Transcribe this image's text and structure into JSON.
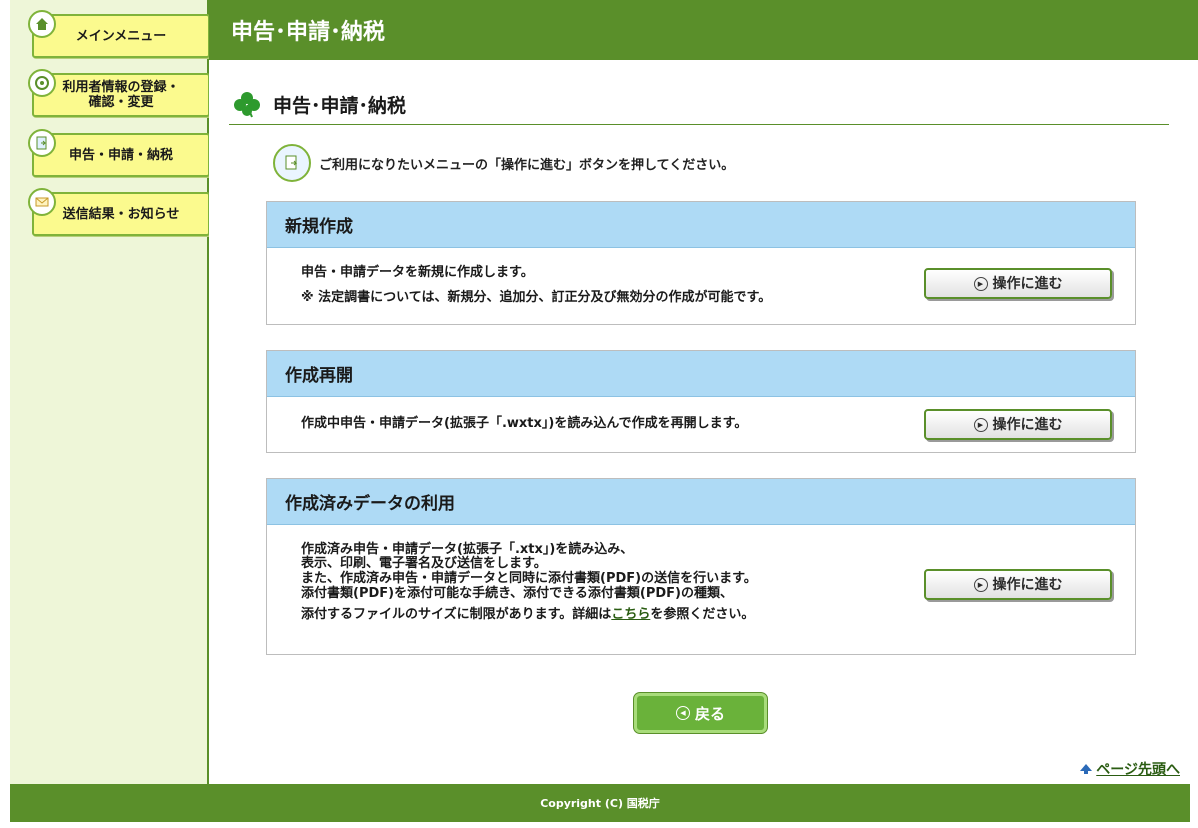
{
  "sidebar": {
    "items": [
      {
        "label": "メインメニュー",
        "icon": "home-icon"
      },
      {
        "label": "利用者情報の登録・\n確認・変更",
        "icon": "user-info-icon"
      },
      {
        "label": "申告・申請・納税",
        "icon": "document-icon"
      },
      {
        "label": "送信結果・お知らせ",
        "icon": "mail-icon"
      }
    ]
  },
  "header": {
    "title": "申告･申請･納税"
  },
  "main": {
    "heading": "申告･申請･納税",
    "instruction": "ご利用になりたいメニューの「操作に進む」ボタンを押してください。",
    "sections": [
      {
        "title": "新規作成",
        "lines": [
          "申告・申請データを新規に作成します。",
          "※ 法定調書については、新規分、追加分、訂正分及び無効分の作成が可能です。"
        ],
        "button": "操作に進む"
      },
      {
        "title": "作成再開",
        "lines": [
          "作成中申告・申請データ(拡張子「.wxtx」)を読み込んで作成を再開します。"
        ],
        "button": "操作に進む"
      },
      {
        "title": "作成済みデータの利用",
        "lines": [
          "作成済み申告・申請データ(拡張子「.xtx」)を読み込み、",
          "表示、印刷、電子署名及び送信をします。",
          "また、作成済み申告・申請データと同時に添付書類(PDF)の送信を行います。",
          "添付書類(PDF)を添付可能な手続き、添付できる添付書類(PDF)の種類、",
          "添付するファイルのサイズに制限があります。詳細は"
        ],
        "link_text": "こちら",
        "after_link": "を参照ください。",
        "button": "操作に進む"
      }
    ],
    "back_button": "戻る",
    "page_top": "ページ先頭へ"
  },
  "footer": {
    "copyright": "Copyright (C) 国税庁"
  },
  "colors": {
    "brand_green": "#5a8f2a",
    "sidebar_bg": "#eef6d8",
    "section_header": "#aedaf5",
    "sidebar_button": "#fbfa8e"
  }
}
